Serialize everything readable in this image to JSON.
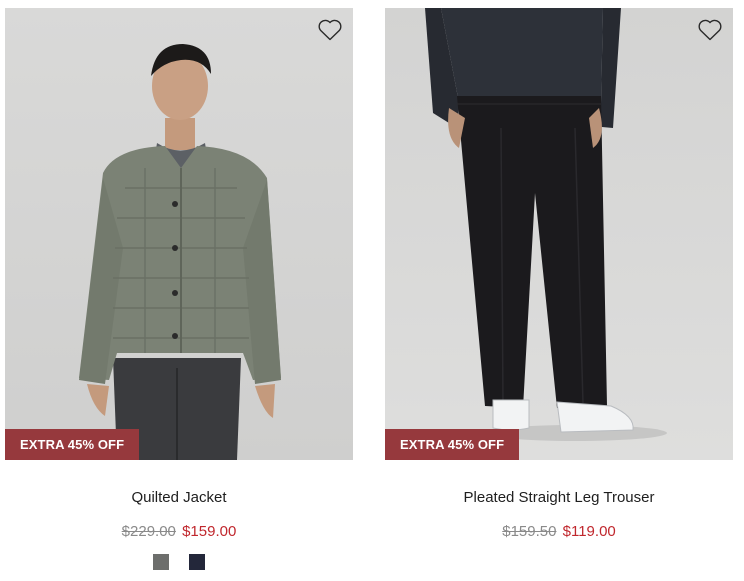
{
  "products": [
    {
      "name": "Quilted Jacket",
      "badge": "EXTRA 45% OFF",
      "original_price": "$229.00",
      "sale_price": "$159.00",
      "swatches": [
        "#6d6e6c",
        "#23273a"
      ],
      "wishlist_icon": "heart-outline-icon"
    },
    {
      "name": "Pleated Straight Leg Trouser",
      "badge": "EXTRA 45% OFF",
      "original_price": "$159.50",
      "sale_price": "$119.00",
      "swatches": [],
      "wishlist_icon": "heart-outline-icon"
    }
  ],
  "colors": {
    "badge_bg": "#96393d",
    "sale_price": "#c0272d",
    "original_price": "#8a8a8a",
    "photo_bg": "#d5d5d4"
  }
}
